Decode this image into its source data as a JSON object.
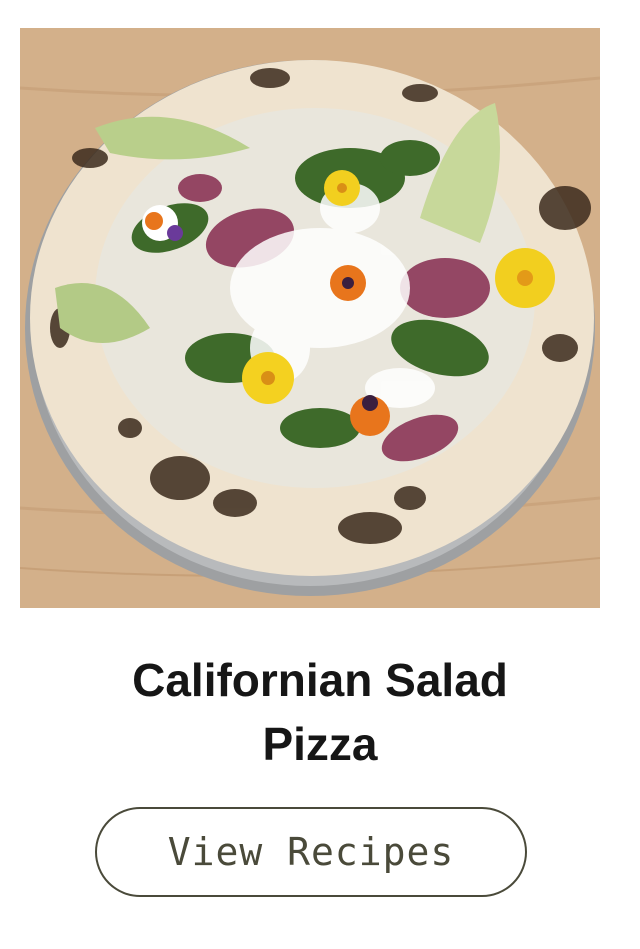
{
  "card": {
    "image_alt": "Californian Salad Pizza",
    "title_line1": "Californian Salad",
    "title_line2": "Pizza",
    "button_label": "View Recipes"
  }
}
